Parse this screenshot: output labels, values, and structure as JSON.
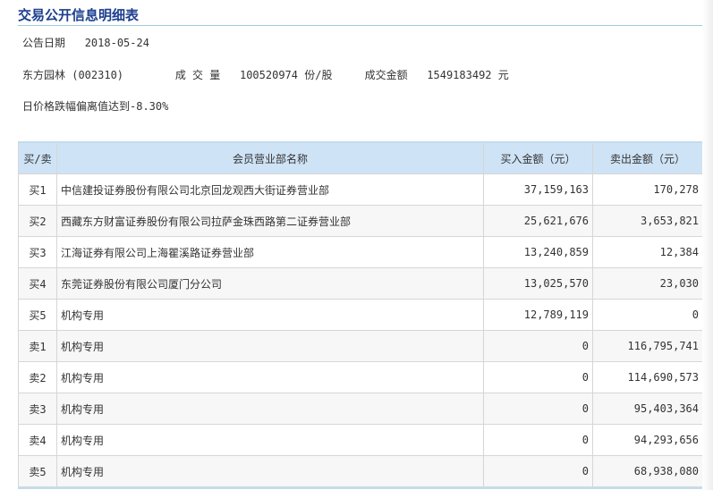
{
  "title": "交易公开信息明细表",
  "date_label": "公告日期",
  "date": "2018-05-24",
  "stock": "东方园林 (002310)",
  "volume_label": "成 交 量",
  "volume": "100520974 份/股",
  "amount_label": "成交金额",
  "amount": "1549183492 元",
  "reason": "日价格跌幅偏离值达到-8.30%",
  "table": {
    "headers": [
      "买/卖",
      "会员营业部名称",
      "买入金额（元）",
      "卖出金额（元）"
    ],
    "rows": [
      [
        "买1",
        "中信建投证券股份有限公司北京回龙观西大街证券营业部",
        "37,159,163",
        "170,278"
      ],
      [
        "买2",
        "西藏东方财富证券股份有限公司拉萨金珠西路第二证券营业部",
        "25,621,676",
        "3,653,821"
      ],
      [
        "买3",
        "江海证券有限公司上海瞿溪路证券营业部",
        "13,240,859",
        "12,384"
      ],
      [
        "买4",
        "东莞证券股份有限公司厦门分公司",
        "13,025,570",
        "23,030"
      ],
      [
        "买5",
        "机构专用",
        "12,789,119",
        "0"
      ],
      [
        "卖1",
        "机构专用",
        "0",
        "116,795,741"
      ],
      [
        "卖2",
        "机构专用",
        "0",
        "114,690,573"
      ],
      [
        "卖3",
        "机构专用",
        "0",
        "95,403,364"
      ],
      [
        "卖4",
        "机构专用",
        "0",
        "94,293,656"
      ],
      [
        "卖5",
        "机构专用",
        "0",
        "68,938,080"
      ]
    ]
  }
}
